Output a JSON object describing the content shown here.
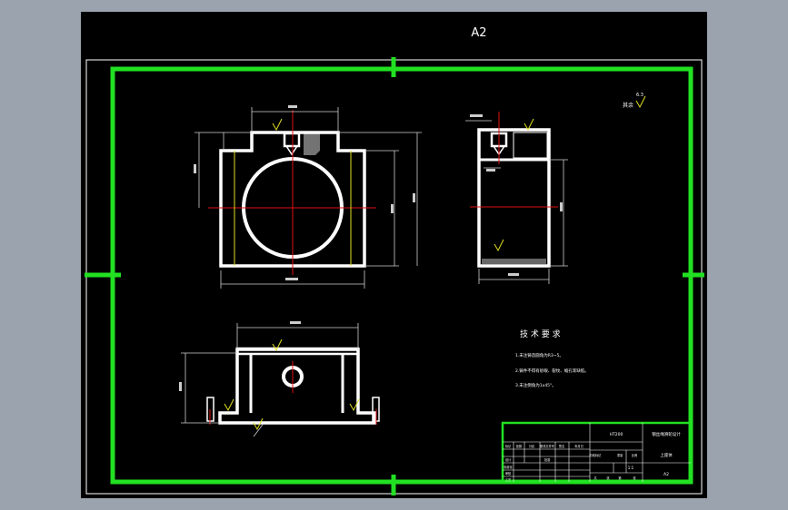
{
  "sheet": {
    "size_label": "A2",
    "background": "#000000",
    "frame_color": "#22e022",
    "line_color": "#ffffff",
    "centerline_color": "#e01010",
    "dimension_color": "#d0d0d0"
  },
  "roughness": {
    "label": "其余",
    "value": "6.3"
  },
  "tech_requirements": {
    "title": "技 术 要 求",
    "items": [
      "1.未注铸造圆角为R3~5。",
      "2.铸件不得有砂眼、裂纹、缩孔等缺陷。",
      "3.未注倒角为1x45°。"
    ]
  },
  "title_block": {
    "part_name": "上座体",
    "project": "钢丝绳滑轮设计",
    "material": "HT200",
    "sheet_code": "A2",
    "scale": "1:1",
    "labels": [
      "标记",
      "处数",
      "分区",
      "更改文件号",
      "签名",
      "年月日",
      "设计",
      "标准化",
      "审核",
      "工艺",
      "批准",
      "阶段标记",
      "重量",
      "比例",
      "共",
      "张",
      "第",
      "张"
    ]
  }
}
